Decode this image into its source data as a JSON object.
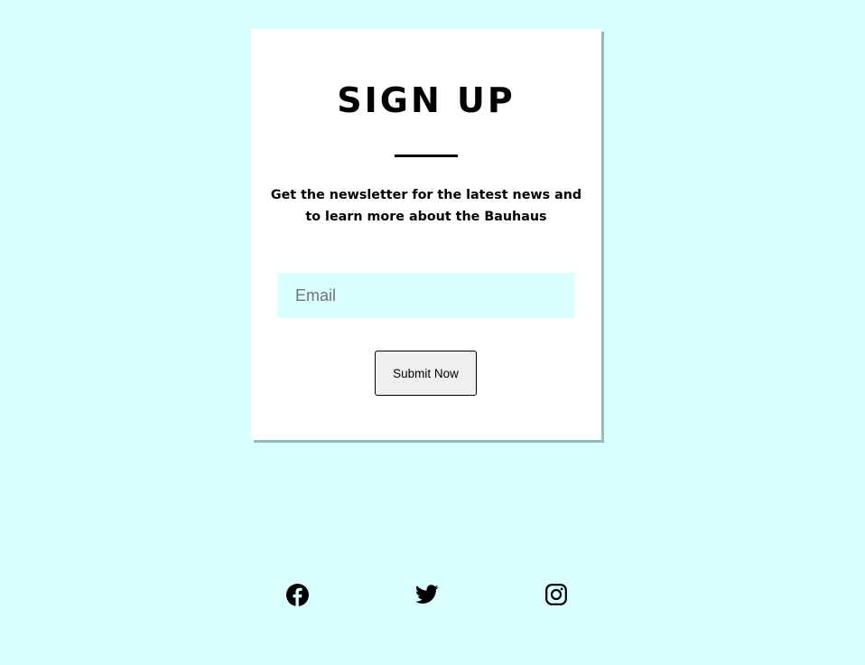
{
  "signup": {
    "title": "SIGN UP",
    "description": "Get the newsletter for the latest news and to learn more about the Bauhaus",
    "email_placeholder": "Email",
    "email_value": "",
    "submit_label": "Submit Now"
  },
  "social": {
    "icons": [
      "facebook-icon",
      "twitter-icon",
      "instagram-icon"
    ]
  },
  "colors": {
    "page_background": "#d9ffff",
    "card_background": "#ffffff",
    "card_shadow": "#8fbcbf",
    "input_background": "#d9ffff",
    "button_background": "#efefef",
    "text": "#000000"
  }
}
